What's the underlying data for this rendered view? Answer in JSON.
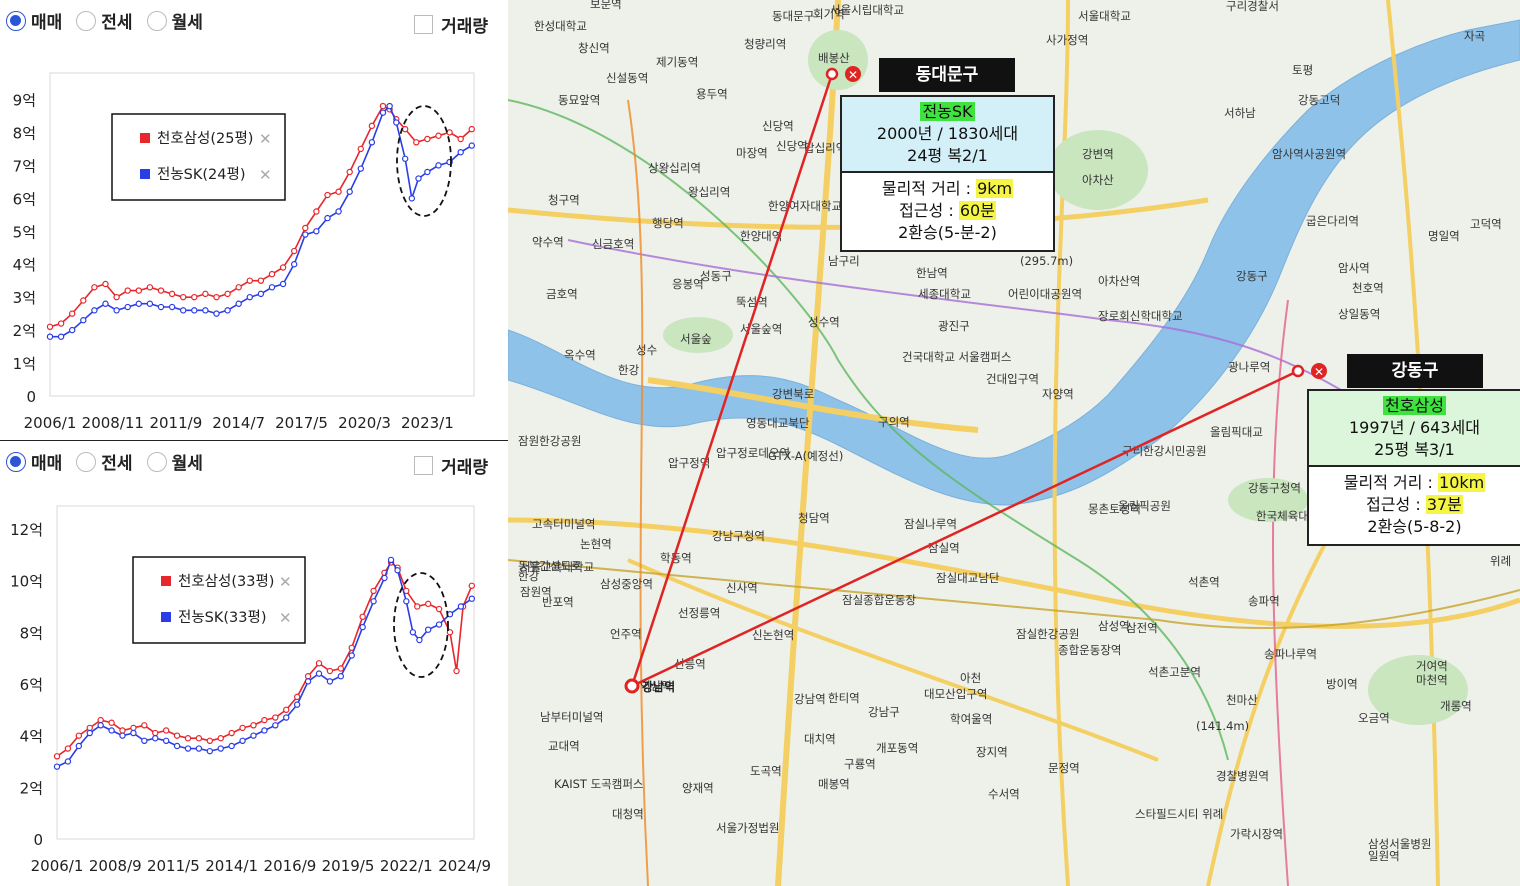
{
  "radio_labels": [
    "매매",
    "전세",
    "월세"
  ],
  "volume_label": "거래량",
  "charts": [
    {
      "legend": [
        {
          "name": "천호삼성(25평)",
          "color": "#e8262b"
        },
        {
          "name": "전농SK(24평)",
          "color": "#2a3de6"
        }
      ],
      "y_ticks": [
        "0",
        "1억",
        "2억",
        "3억",
        "4억",
        "5억",
        "6억",
        "7억",
        "8억",
        "9억"
      ],
      "x_ticks": [
        "2006/1",
        "2008/11",
        "2011/9",
        "2014/7",
        "2017/5",
        "2020/3",
        "2023/1"
      ]
    },
    {
      "legend": [
        {
          "name": "천호삼성(33평)",
          "color": "#e8262b"
        },
        {
          "name": "전농SK(33평)",
          "color": "#2a3de6"
        }
      ],
      "y_ticks": [
        "0",
        "2억",
        "4억",
        "6억",
        "8억",
        "10억",
        "12억"
      ],
      "x_ticks": [
        "2006/1",
        "2008/9",
        "2011/5",
        "2014/1",
        "2016/9",
        "2019/5",
        "2022/1",
        "2024/9"
      ]
    }
  ],
  "chart_data": [
    {
      "type": "line",
      "title": "",
      "ylabel": "",
      "xlabel": "",
      "ylim": [
        0,
        9.5
      ],
      "x_unit": "year",
      "series": [
        {
          "name": "천호삼성(25평)",
          "color": "#e8262b",
          "x": [
            2006.0,
            2006.5,
            2007.0,
            2007.5,
            2008.0,
            2008.5,
            2009.0,
            2009.5,
            2010.0,
            2010.5,
            2011.0,
            2011.5,
            2012.0,
            2012.5,
            2013.0,
            2013.5,
            2014.0,
            2014.5,
            2015.0,
            2015.5,
            2016.0,
            2016.5,
            2017.0,
            2017.5,
            2018.0,
            2018.5,
            2019.0,
            2019.5,
            2020.0,
            2020.5,
            2021.0,
            2021.3,
            2021.6,
            2022.0,
            2022.5,
            2023.0,
            2023.5,
            2024.0,
            2024.5,
            2025.0
          ],
          "y": [
            2.1,
            2.2,
            2.5,
            2.9,
            3.3,
            3.4,
            3.0,
            3.2,
            3.2,
            3.3,
            3.2,
            3.1,
            3.0,
            3.0,
            3.1,
            3.0,
            3.1,
            3.3,
            3.5,
            3.5,
            3.7,
            3.9,
            4.4,
            5.1,
            5.6,
            6.1,
            6.2,
            6.8,
            7.5,
            8.2,
            8.8,
            8.7,
            8.4,
            8.1,
            7.7,
            7.8,
            7.9,
            8.0,
            7.8,
            8.1
          ]
        },
        {
          "name": "전농SK(24평)",
          "color": "#2a3de6",
          "x": [
            2006.0,
            2006.5,
            2007.0,
            2007.5,
            2008.0,
            2008.5,
            2009.0,
            2009.5,
            2010.0,
            2010.5,
            2011.0,
            2011.5,
            2012.0,
            2012.5,
            2013.0,
            2013.5,
            2014.0,
            2014.5,
            2015.0,
            2015.5,
            2016.0,
            2016.5,
            2017.0,
            2017.5,
            2018.0,
            2018.5,
            2019.0,
            2019.5,
            2020.0,
            2020.5,
            2021.0,
            2021.3,
            2021.6,
            2022.0,
            2022.3,
            2022.6,
            2023.0,
            2023.5,
            2024.0,
            2024.5,
            2025.0
          ],
          "y": [
            1.8,
            1.8,
            2.0,
            2.3,
            2.6,
            2.8,
            2.6,
            2.7,
            2.8,
            2.8,
            2.7,
            2.7,
            2.6,
            2.6,
            2.6,
            2.5,
            2.6,
            2.8,
            3.0,
            3.1,
            3.3,
            3.4,
            4.0,
            4.9,
            5.0,
            5.4,
            5.6,
            6.2,
            6.9,
            7.7,
            8.6,
            8.8,
            8.3,
            7.2,
            6.0,
            6.6,
            6.8,
            7.0,
            7.1,
            7.4,
            7.6
          ]
        }
      ]
    },
    {
      "type": "line",
      "title": "",
      "ylabel": "",
      "xlabel": "",
      "ylim": [
        0,
        12.5
      ],
      "x_unit": "year",
      "series": [
        {
          "name": "천호삼성(33평)",
          "color": "#e8262b",
          "x": [
            2006.0,
            2006.5,
            2007.0,
            2007.5,
            2008.0,
            2008.5,
            2009.0,
            2009.5,
            2010.0,
            2010.5,
            2011.0,
            2011.5,
            2012.0,
            2012.5,
            2013.0,
            2013.5,
            2014.0,
            2014.5,
            2015.0,
            2015.5,
            2016.0,
            2016.5,
            2017.0,
            2017.5,
            2018.0,
            2018.5,
            2019.0,
            2019.5,
            2020.0,
            2020.5,
            2021.0,
            2021.3,
            2021.6,
            2022.0,
            2022.5,
            2023.0,
            2023.5,
            2024.0,
            2024.3,
            2024.6,
            2025.0
          ],
          "y": [
            3.2,
            3.5,
            4.0,
            4.3,
            4.6,
            4.5,
            4.2,
            4.3,
            4.4,
            4.1,
            4.2,
            4.0,
            3.9,
            3.9,
            3.8,
            3.9,
            4.1,
            4.3,
            4.4,
            4.6,
            4.7,
            5.0,
            5.5,
            6.3,
            6.8,
            6.5,
            6.6,
            7.4,
            8.6,
            9.6,
            10.3,
            10.7,
            10.5,
            9.6,
            9.0,
            9.1,
            8.9,
            8.0,
            6.5,
            9.0,
            9.8
          ]
        },
        {
          "name": "전농SK(33평)",
          "color": "#2a3de6",
          "x": [
            2006.0,
            2006.5,
            2007.0,
            2007.5,
            2008.0,
            2008.5,
            2009.0,
            2009.5,
            2010.0,
            2010.5,
            2011.0,
            2011.5,
            2012.0,
            2012.5,
            2013.0,
            2013.5,
            2014.0,
            2014.5,
            2015.0,
            2015.5,
            2016.0,
            2016.5,
            2017.0,
            2017.5,
            2018.0,
            2018.5,
            2019.0,
            2019.5,
            2020.0,
            2020.5,
            2021.0,
            2021.3,
            2021.6,
            2022.0,
            2022.3,
            2022.6,
            2023.0,
            2023.5,
            2024.0,
            2024.5,
            2025.0
          ],
          "y": [
            2.8,
            3.0,
            3.6,
            4.1,
            4.4,
            4.2,
            4.0,
            4.1,
            3.8,
            3.9,
            3.8,
            3.6,
            3.5,
            3.5,
            3.4,
            3.5,
            3.6,
            3.8,
            4.0,
            4.2,
            4.4,
            4.7,
            5.2,
            6.1,
            6.4,
            6.1,
            6.3,
            7.1,
            8.2,
            9.2,
            10.1,
            10.8,
            10.4,
            9.2,
            8.0,
            7.7,
            8.1,
            8.3,
            8.7,
            9.0,
            9.3
          ]
        }
      ]
    }
  ],
  "map": {
    "districts": [
      {
        "tag": "동대문구",
        "apt_name": "전농SK",
        "line1": "2000년 / 1830세대",
        "line2": "24평 복2/1",
        "dist_label": "물리적 거리 : ",
        "dist_value": "9km",
        "access_label": "접근성 : ",
        "access_value": "60분",
        "transfer": "2환승(5-분-2)"
      },
      {
        "tag": "강동구",
        "apt_name": "천호삼성",
        "line1": "1997년 / 643세대",
        "line2": "25평 복3/1",
        "dist_label": "물리적 거리 : ",
        "dist_value": "10km",
        "access_label": "접근성 : ",
        "access_value": "37분",
        "transfer": "2환승(5-8-2)"
      }
    ],
    "target_label": "강남역",
    "place_labels": [
      "동대문구",
      "청량리역",
      "회기역",
      "서울시립대학교",
      "사가정역",
      "서울대학교",
      "구리경찰서",
      "보문역",
      "한성대학교",
      "창신역",
      "신설동역",
      "제기동역",
      "배봉산",
      "동묘앞역",
      "용두역",
      "신당역",
      "상왕십리역",
      "왕십리역",
      "신당역",
      "마장역",
      "답십리역",
      "청구역",
      "행당역",
      "한양대역",
      "한양여자대학교",
      "약수역",
      "신금호역",
      "응봉역",
      "금호역",
      "성동구",
      "뚝섬역",
      "서울숲",
      "성수역",
      "서울숲역",
      "옥수역",
      "성수",
      "한강",
      "강변북로",
      "영동대교북단",
      "압구정역",
      "압구정로데오역",
      "청담역",
      "강남구청역",
      "학동역",
      "삼성중앙역",
      "논현역",
      "신사역",
      "선정릉역",
      "언주역",
      "신논현역",
      "선릉역",
      "역삼역",
      "강남역",
      "한티역",
      "강남구",
      "대치역",
      "도곡역",
      "매봉역",
      "양재역",
      "구룡역",
      "개포동역",
      "대모산입구역",
      "학여울역",
      "대청역",
      "서울가정법원",
      "KAIST 도곡캠퍼스",
      "남부터미널역",
      "교대역",
      "서울교육대학교",
      "잠원역",
      "반포역",
      "고속터미널역",
      "잠원한강공원",
      "한남역",
      "세종대학교",
      "어린이대공원역",
      "광진구",
      "건국대학교 서울캠퍼스",
      "건대입구역",
      "구의역",
      "자양역",
      "강변역",
      "아차산",
      "(295.7m)",
      "아차산역",
      "장로회신학대학교",
      "광나루역",
      "천호역",
      "강동구",
      "암사역",
      "명일역",
      "고덕역",
      "상일동역",
      "굽은다리역",
      "암사역사공원역",
      "강동고덕",
      "구리한강시민공원",
      "올림픽대교",
      "강동구청역",
      "한국체육대학교",
      "올림픽공원",
      "몽촌토성역",
      "잠실나루역",
      "잠실역",
      "잠실대교남단",
      "잠실종합운동장",
      "잠실한강공원",
      "종합운동장역",
      "삼성역",
      "삼전역",
      "석촌고분역",
      "석촌역",
      "송파역",
      "송파나루역",
      "방이역",
      "오금역",
      "개롱역",
      "거여역",
      "마천역",
      "천마산",
      "(141.4m)",
      "경찰병원역",
      "가락시장역",
      "문정역",
      "장지역",
      "수서역",
      "삼성서울병원",
      "일원역",
      "스타필드시티 위례",
      "위례",
      "자곡",
      "서하남",
      "토평",
      "아천",
      "남구리",
      "GTX-A(예정선)",
      "동부간선도로",
      "한강"
    ]
  }
}
